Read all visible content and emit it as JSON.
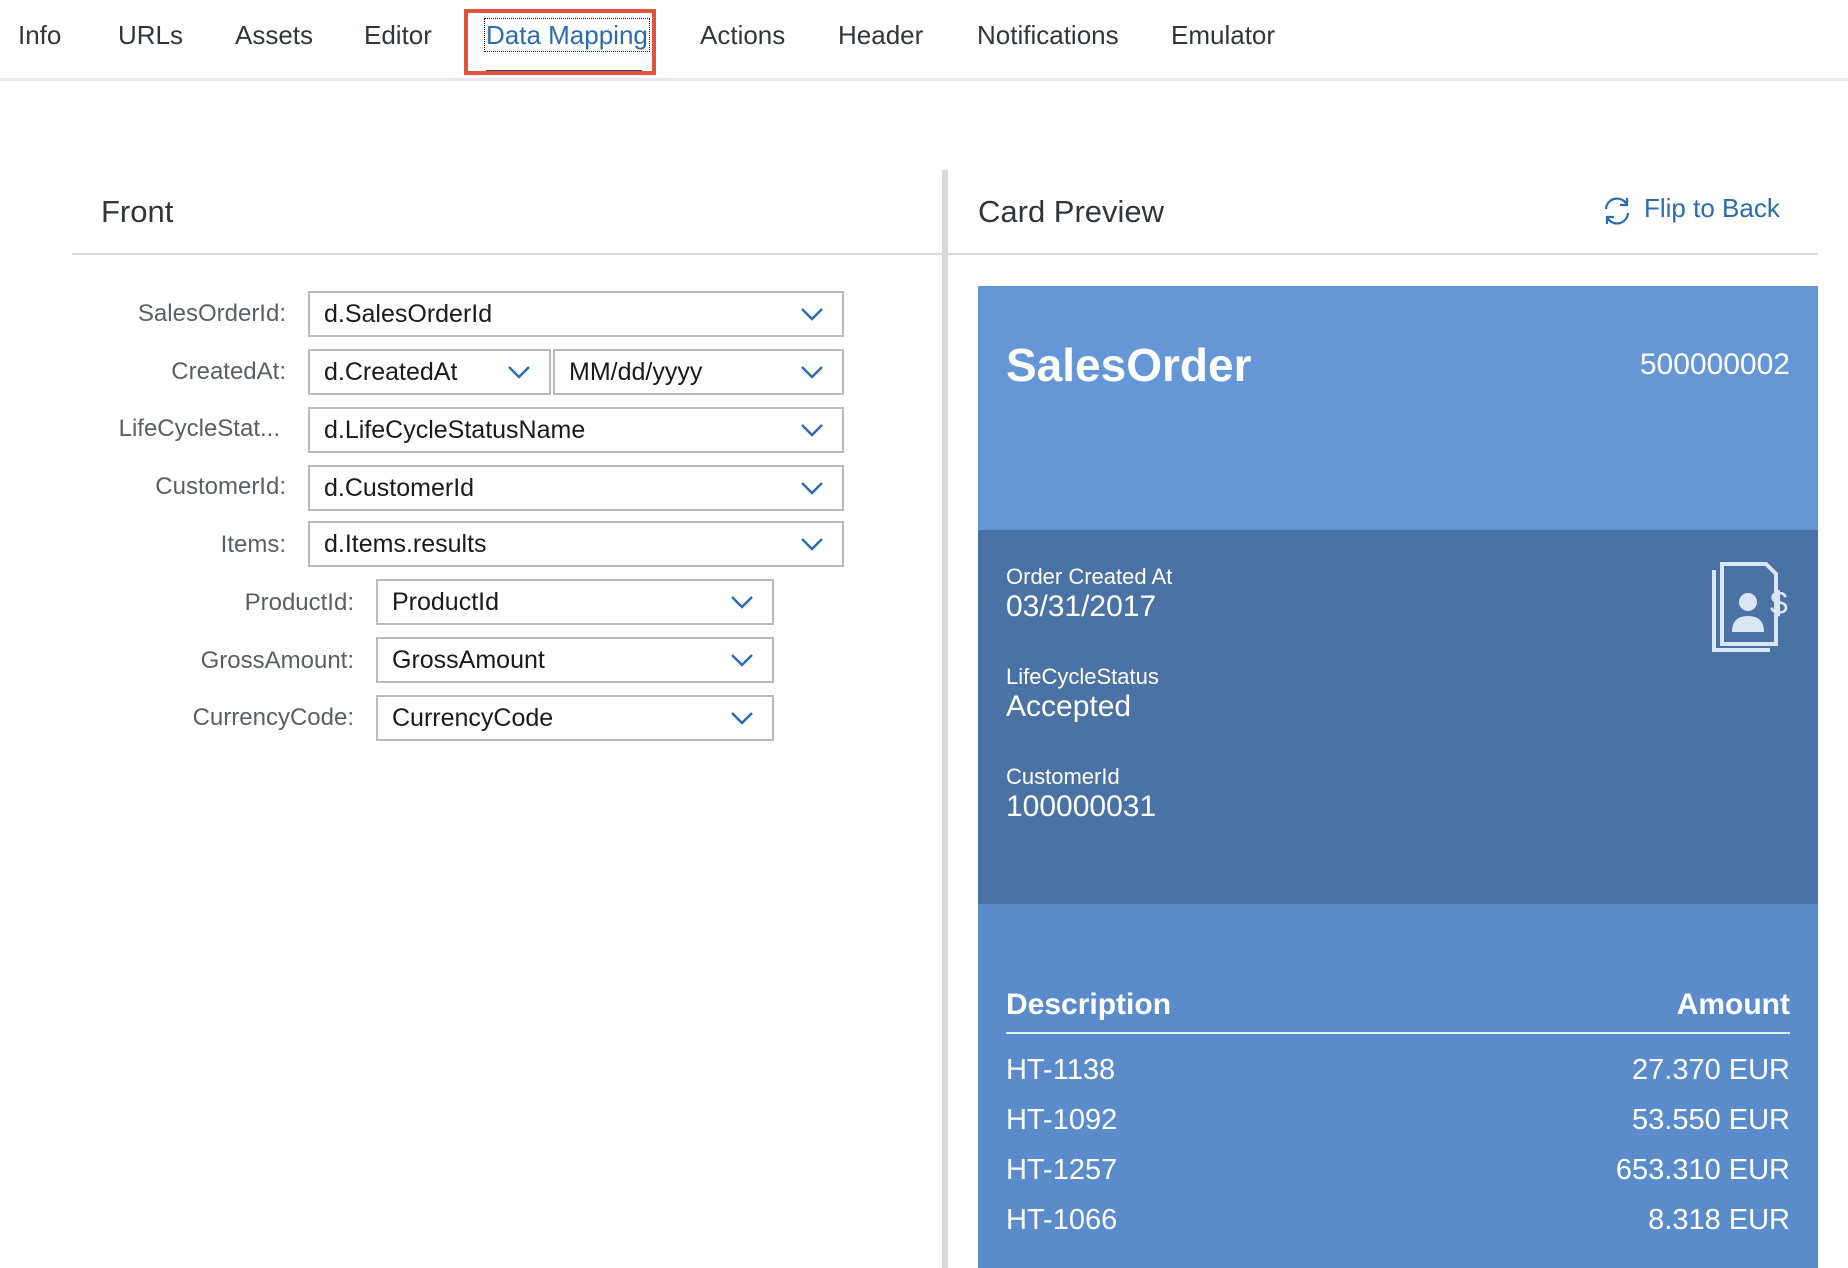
{
  "tabs": [
    {
      "label": "Info"
    },
    {
      "label": "URLs"
    },
    {
      "label": "Assets"
    },
    {
      "label": "Editor"
    },
    {
      "label": "Data Mapping",
      "active": true
    },
    {
      "label": "Actions"
    },
    {
      "label": "Header"
    },
    {
      "label": "Notifications"
    },
    {
      "label": "Emulator"
    }
  ],
  "front": {
    "title": "Front",
    "fields": {
      "sales_order_id": {
        "label": "SalesOrderId:",
        "value": "d.SalesOrderId"
      },
      "created_at": {
        "label": "CreatedAt:",
        "value": "d.CreatedAt",
        "format": "MM/dd/yyyy"
      },
      "lifecycle_status": {
        "label": "LifeCycleStat...",
        "value": "d.LifeCycleStatusName"
      },
      "customer_id": {
        "label": "CustomerId:",
        "value": "d.CustomerId"
      },
      "items": {
        "label": "Items:",
        "value": "d.Items.results"
      },
      "product_id": {
        "label": "ProductId:",
        "value": "ProductId"
      },
      "gross_amount": {
        "label": "GrossAmount:",
        "value": "GrossAmount"
      },
      "currency_code": {
        "label": "CurrencyCode:",
        "value": "CurrencyCode"
      }
    }
  },
  "preview": {
    "title": "Card Preview",
    "flip_label": "Flip to Back",
    "flip_icon": "refresh-icon",
    "card": {
      "title": "SalesOrder",
      "number": "500000002",
      "order_created_label": "Order Created At",
      "order_created_value": "03/31/2017",
      "lifecycle_label": "LifeCycleStatus",
      "lifecycle_value": "Accepted",
      "customer_label": "CustomerId",
      "customer_value": "100000031",
      "icon": "customer-document-dollar-icon",
      "table_headers": {
        "description": "Description",
        "amount": "Amount"
      },
      "rows": [
        {
          "description": "HT-1138",
          "amount": "27.370 EUR"
        },
        {
          "description": "HT-1092",
          "amount": "53.550 EUR"
        },
        {
          "description": "HT-1257",
          "amount": "653.310 EUR"
        },
        {
          "description": "HT-1066",
          "amount": "8.318 EUR"
        }
      ]
    }
  },
  "colors": {
    "accent": "#2b6cb0",
    "highlight": "#e0533c",
    "card_header": "#6596d6",
    "card_middle": "#4a72a5",
    "card_bottom": "#5a8ccc"
  }
}
